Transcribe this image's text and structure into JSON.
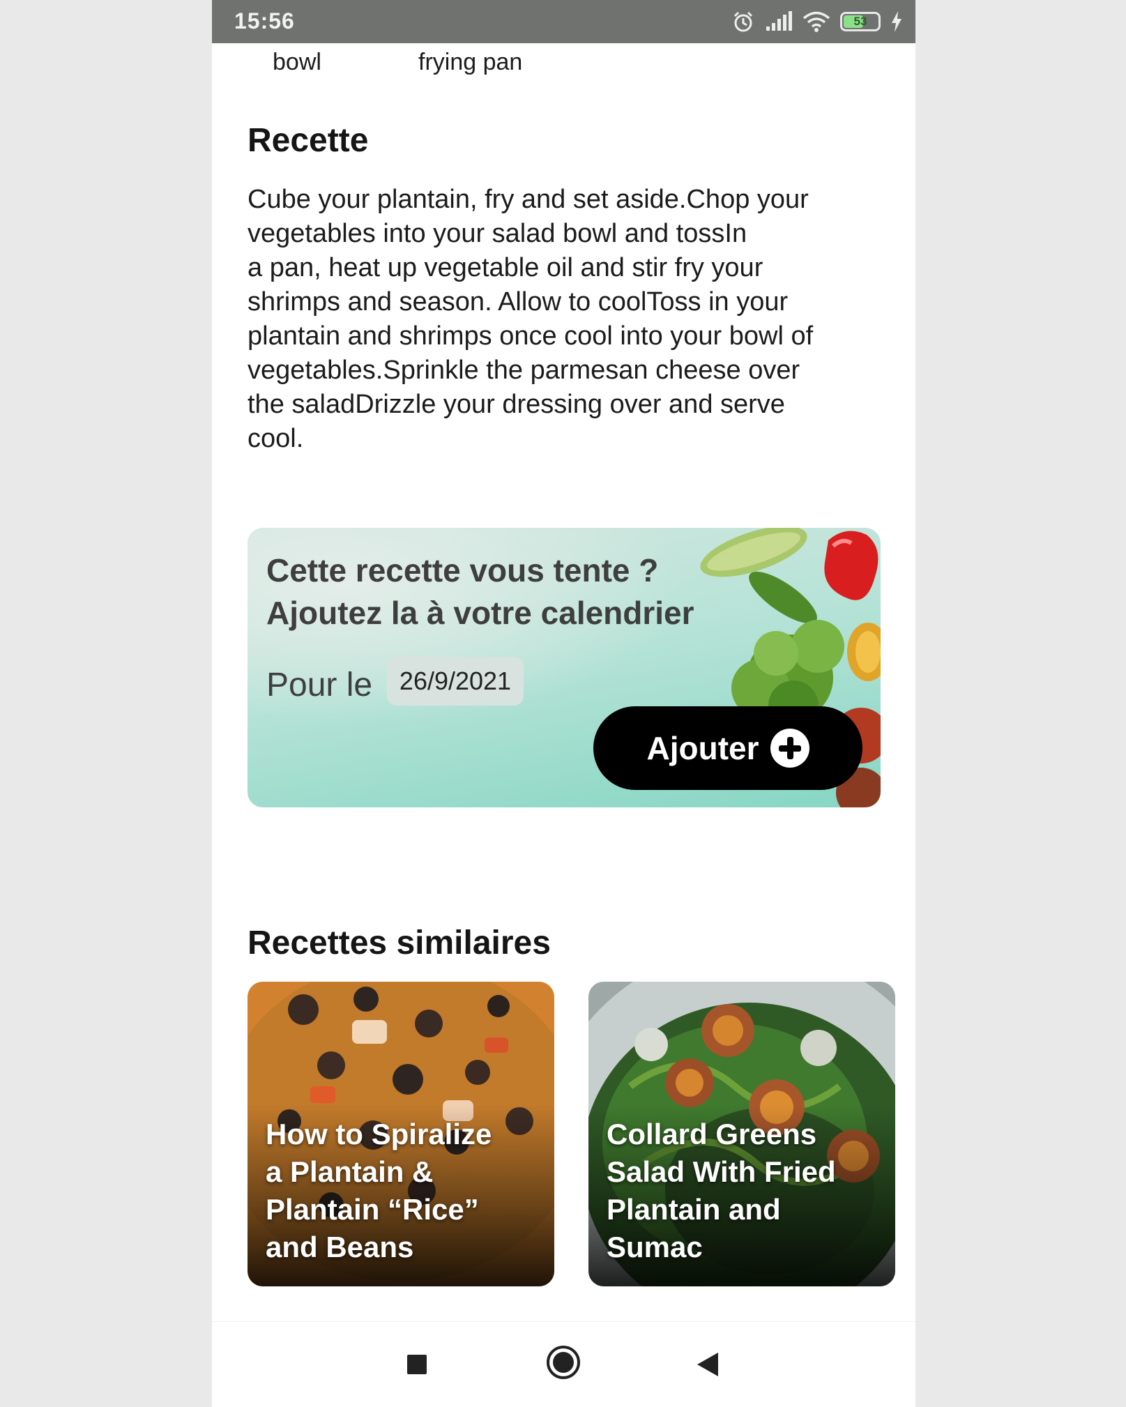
{
  "status_bar": {
    "time": "15:56",
    "battery_level": "53",
    "icons": [
      "alarm-icon",
      "signal-icon",
      "wifi-icon",
      "battery-icon",
      "charging-icon"
    ]
  },
  "utensils": [
    "bowl",
    "frying pan"
  ],
  "recipe": {
    "title": "Recette",
    "lines": [
      "Cube your plantain, fry and set aside.Chop your",
      "vegetables into your salad bowl and tossIn",
      "a pan, heat up vegetable oil and stir fry your",
      "shrimps and season. Allow to coolToss in your",
      "plantain and shrimps once cool into your bowl of",
      "vegetables.Sprinkle the parmesan cheese over",
      "the saladDrizzle your dressing over and serve",
      "cool."
    ]
  },
  "calendar_card": {
    "line1": "Cette recette vous tente ?",
    "line2": "Ajoutez la à votre calendrier",
    "date_label": "Pour le",
    "date_value": "26/9/2021",
    "button_label": "Ajouter",
    "button_icon": "plus-circle-icon"
  },
  "similar": {
    "title": "Recettes similaires",
    "items": [
      {
        "lines": [
          "How to Spiralize",
          "a Plantain &",
          "Plantain “Rice”",
          "and Beans"
        ]
      },
      {
        "lines": [
          "Collard Greens",
          "Salad With Fried",
          "Plantain and",
          "Sumac"
        ]
      }
    ]
  },
  "nav_bar": {
    "buttons": [
      "recents-square-icon",
      "home-circle-icon",
      "back-triangle-icon"
    ]
  },
  "colors": {
    "status_bar": "#6f726f",
    "card_teal": "#86d6c3",
    "button_black": "#000000"
  }
}
